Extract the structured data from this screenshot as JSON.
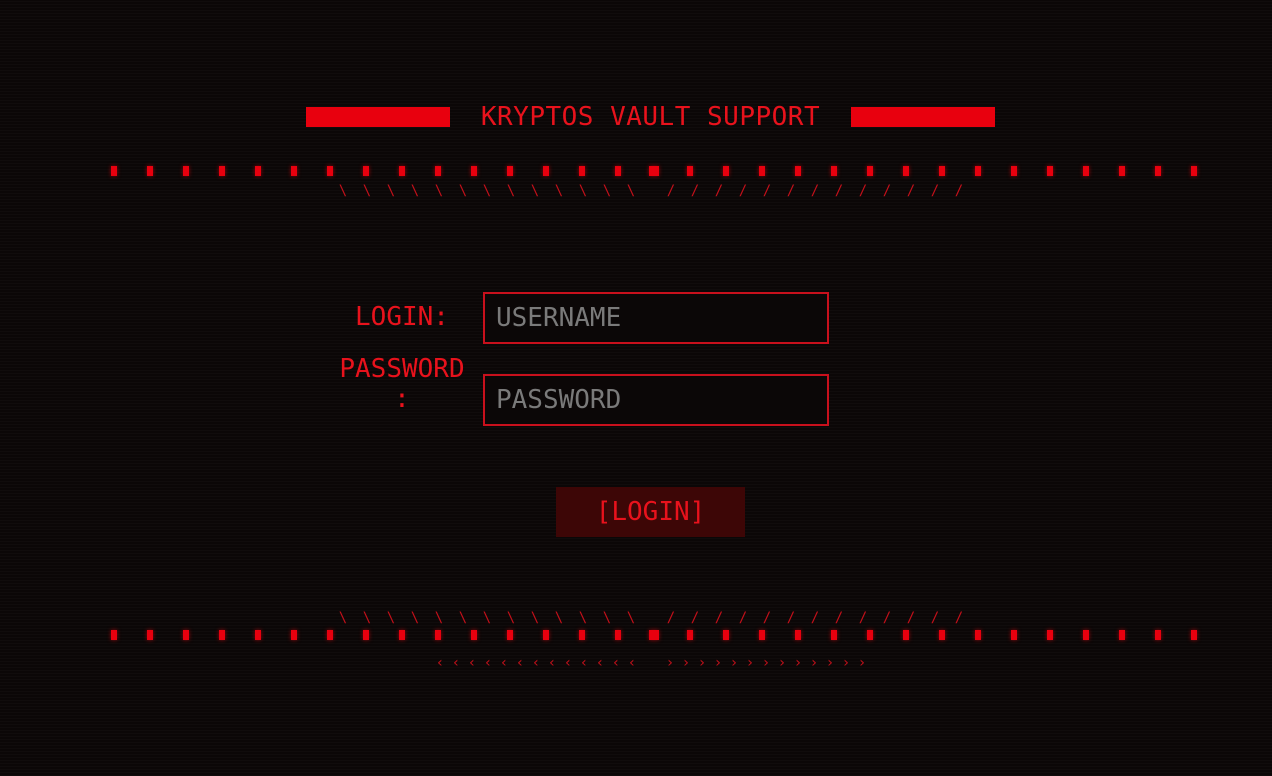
{
  "header": {
    "title": "KRYPTOS VAULT SUPPORT"
  },
  "form": {
    "login_label": "LOGIN:",
    "password_label": "PASSWORD\n:",
    "username_placeholder": "USERNAME",
    "password_placeholder": "PASSWORD",
    "login_button": "[LOGIN]"
  },
  "decor": {
    "down_right_glyph": "⟍",
    "down_left_glyph": "⟋",
    "left_chevron": "‹",
    "right_chevron": "›"
  },
  "colors": {
    "accent": "#e8000e",
    "background": "#0b0707",
    "button_bg": "#3d0606",
    "placeholder": "#7a7a7a"
  }
}
